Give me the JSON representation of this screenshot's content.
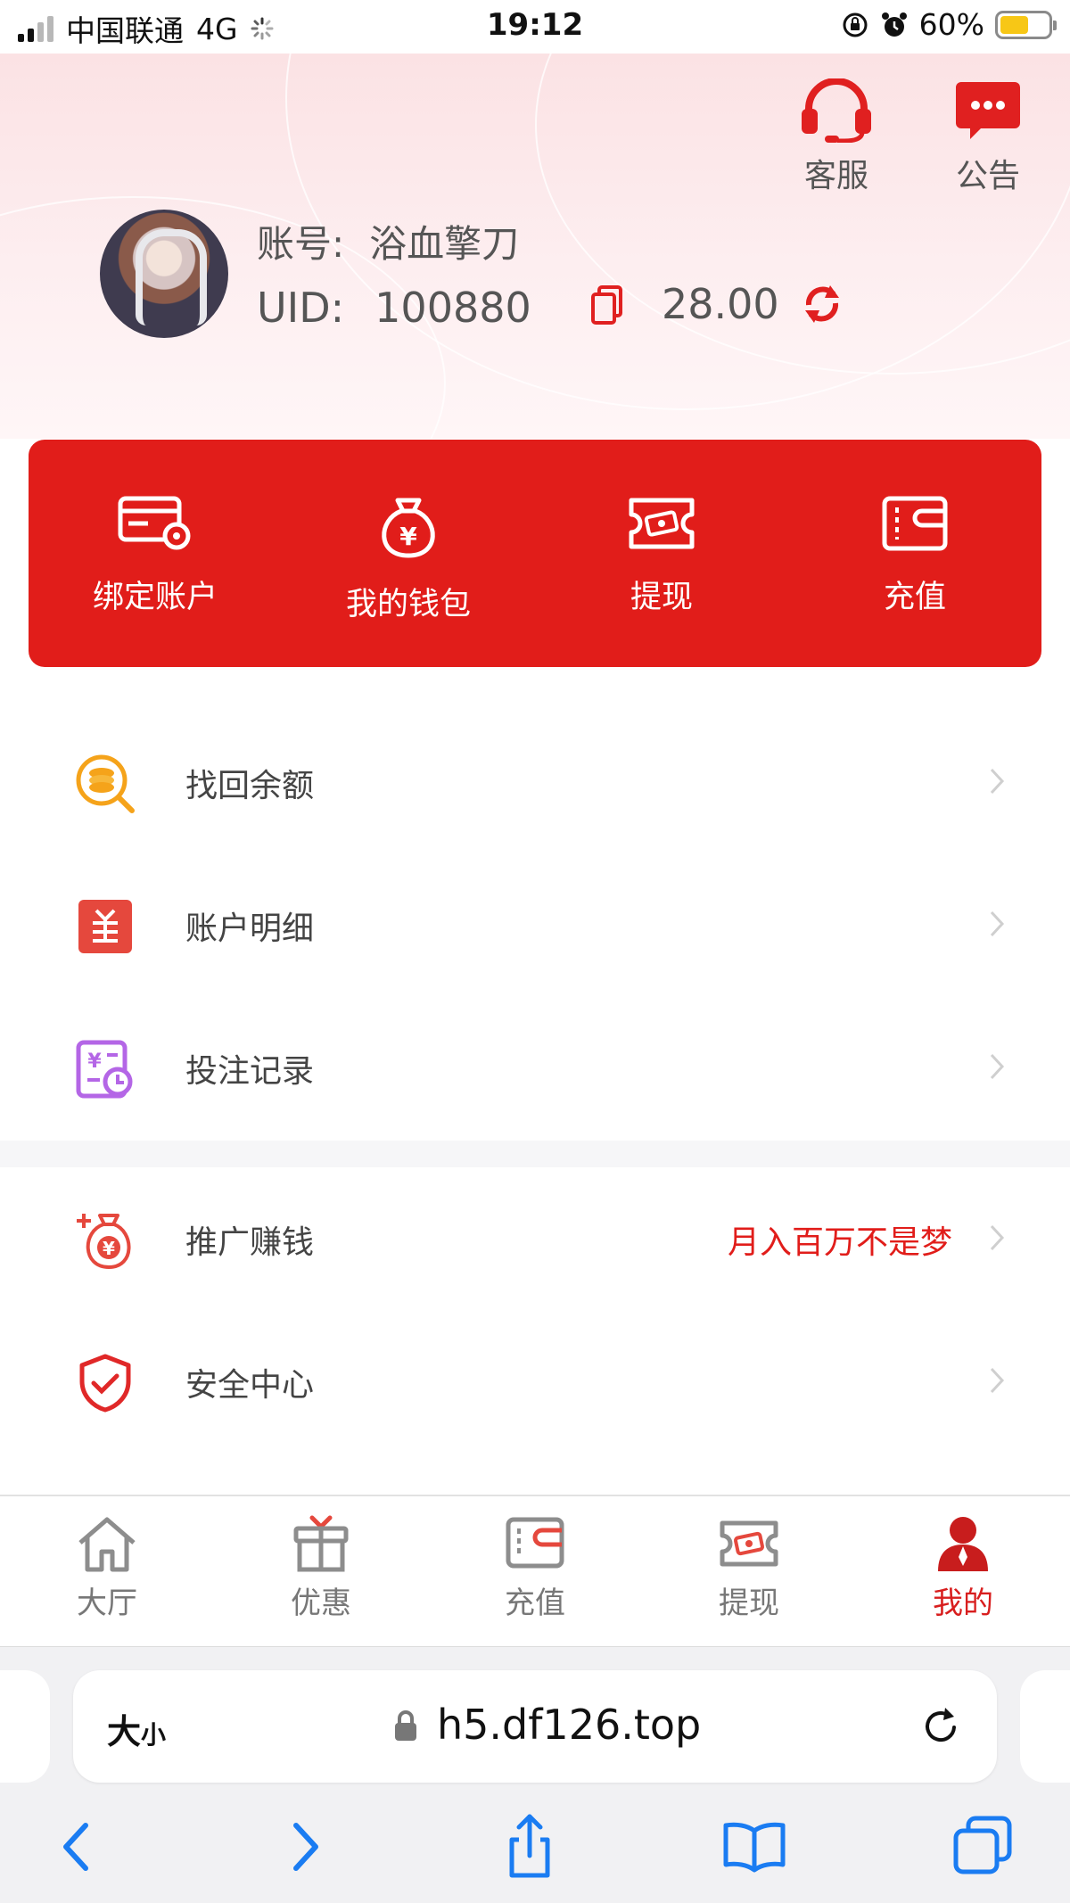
{
  "status_bar": {
    "carrier": "中国联通",
    "network": "4G",
    "time": "19:12",
    "battery": "60%",
    "battery_level": 0.6
  },
  "header": {
    "service_label": "客服",
    "notice_label": "公告",
    "account_label": "账号:",
    "account_value": "浴血擎刀",
    "uid_label": "UID:",
    "uid_value": "100880",
    "balance": "28.00",
    "icons": [
      "headset-icon",
      "chat-bubble-icon",
      "copy-icon",
      "refresh-icon"
    ]
  },
  "actions": [
    {
      "label": "绑定账户",
      "icon": "card-settings-icon"
    },
    {
      "label": "我的钱包",
      "icon": "money-bag-icon"
    },
    {
      "label": "提现",
      "icon": "ticket-cash-icon"
    },
    {
      "label": "充值",
      "icon": "wallet-icon"
    }
  ],
  "menu": [
    {
      "label": "找回余额",
      "icon": "coin-search-icon"
    },
    {
      "label": "账户明细",
      "icon": "ledger-icon"
    },
    {
      "label": "投注记录",
      "icon": "bet-record-icon"
    },
    {
      "label": "推广赚钱",
      "icon": "money-bag-plus-icon",
      "extra": "月入百万不是梦"
    },
    {
      "label": "安全中心",
      "icon": "shield-check-icon"
    }
  ],
  "bottom_nav": [
    {
      "label": "大厅",
      "icon": "home-icon"
    },
    {
      "label": "优惠",
      "icon": "gift-icon"
    },
    {
      "label": "充值",
      "icon": "wallet-icon"
    },
    {
      "label": "提现",
      "icon": "ticket-cash-icon"
    },
    {
      "label": "我的",
      "icon": "user-icon",
      "active": true
    }
  ],
  "browser": {
    "text_size": "大",
    "text_size_small": "小",
    "url": "h5.df126.top"
  },
  "colors": {
    "brand_red": "#e11d1a",
    "header_pink": "#fbe2e4",
    "accent_text_red": "#e11d1a",
    "nav_active": "#d81e1e",
    "browser_blue": "#1a7cf2"
  }
}
